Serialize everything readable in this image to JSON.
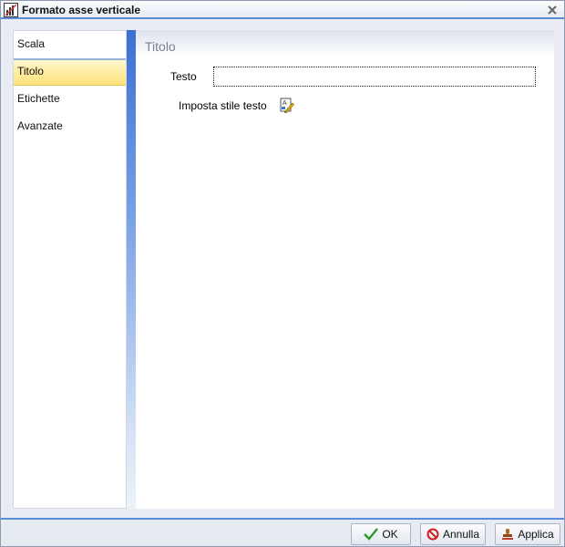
{
  "window": {
    "title": "Formato asse verticale"
  },
  "nav": {
    "items": [
      {
        "label": "Scala",
        "selected": false
      },
      {
        "label": "Titolo",
        "selected": true
      },
      {
        "label": "Etichette",
        "selected": false
      },
      {
        "label": "Avanzate",
        "selected": false
      }
    ]
  },
  "content": {
    "header": "Titolo",
    "text_label": "Testo",
    "text_value": "",
    "style_label": "Imposta stile testo"
  },
  "buttons": {
    "ok": "OK",
    "cancel": "Annulla",
    "apply": "Applica"
  },
  "colors": {
    "accent": "#5b8ed8",
    "selected_bg": "#ffe27a"
  }
}
